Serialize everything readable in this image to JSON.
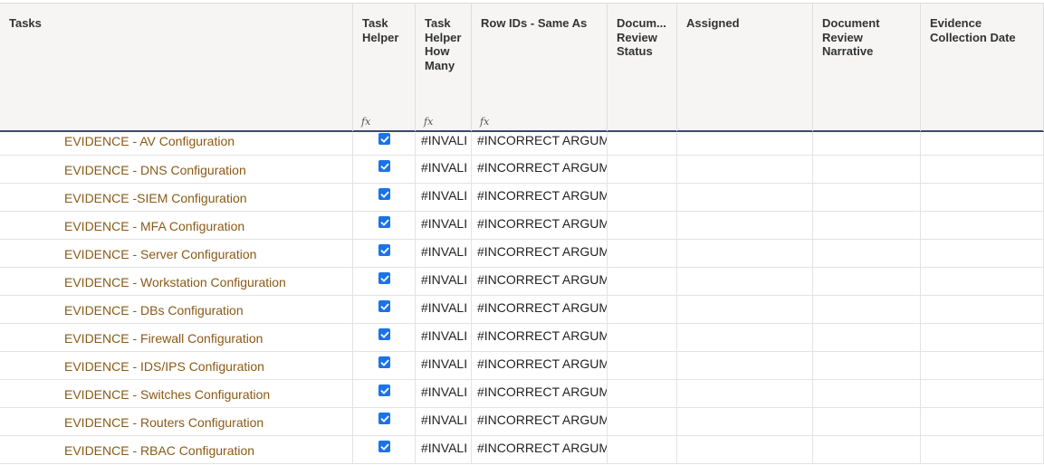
{
  "columns": [
    {
      "key": "tasks",
      "label": "Tasks",
      "formula": false
    },
    {
      "key": "task_helper",
      "label": "Task Helper",
      "formula": true
    },
    {
      "key": "task_helper_how_many",
      "label": "Task Helper How Many",
      "formula": true
    },
    {
      "key": "row_ids",
      "label": "Row IDs - Same As",
      "formula": true
    },
    {
      "key": "doc_review_status",
      "label": "Docum... Review Status",
      "formula": false
    },
    {
      "key": "assigned",
      "label": "Assigned",
      "formula": false
    },
    {
      "key": "doc_review_narrative",
      "label": "Document Review Narrative",
      "formula": false
    },
    {
      "key": "evidence_date",
      "label": "Evidence Collection Date",
      "formula": false
    }
  ],
  "formula_icon": "fx",
  "rows": [
    {
      "task": "EVIDENCE - AV Configuration",
      "helper_checked": true,
      "how_many": "#INVALI",
      "row_ids": "#INCORRECT ARGUM"
    },
    {
      "task": "EVIDENCE - DNS Configuration",
      "helper_checked": true,
      "how_many": "#INVALI",
      "row_ids": "#INCORRECT ARGUM"
    },
    {
      "task": "EVIDENCE -SIEM Configuration",
      "helper_checked": true,
      "how_many": "#INVALI",
      "row_ids": "#INCORRECT ARGUM"
    },
    {
      "task": "EVIDENCE - MFA Configuration",
      "helper_checked": true,
      "how_many": "#INVALI",
      "row_ids": "#INCORRECT ARGUM"
    },
    {
      "task": "EVIDENCE - Server Configuration",
      "helper_checked": true,
      "how_many": "#INVALI",
      "row_ids": "#INCORRECT ARGUM"
    },
    {
      "task": "EVIDENCE - Workstation Configuration",
      "helper_checked": true,
      "how_many": "#INVALI",
      "row_ids": "#INCORRECT ARGUM"
    },
    {
      "task": "EVIDENCE - DBs Configuration",
      "helper_checked": true,
      "how_many": "#INVALI",
      "row_ids": "#INCORRECT ARGUM"
    },
    {
      "task": "EVIDENCE - Firewall Configuration",
      "helper_checked": true,
      "how_many": "#INVALI",
      "row_ids": "#INCORRECT ARGUM"
    },
    {
      "task": "EVIDENCE - IDS/IPS Configuration",
      "helper_checked": true,
      "how_many": "#INVALI",
      "row_ids": "#INCORRECT ARGUM"
    },
    {
      "task": "EVIDENCE - Switches Configuration",
      "helper_checked": true,
      "how_many": "#INVALI",
      "row_ids": "#INCORRECT ARGUM"
    },
    {
      "task": "EVIDENCE - Routers Configuration",
      "helper_checked": true,
      "how_many": "#INVALI",
      "row_ids": "#INCORRECT ARGUM"
    },
    {
      "task": "EVIDENCE - RBAC Configuration",
      "helper_checked": true,
      "how_many": "#INVALI",
      "row_ids": "#INCORRECT ARGUM"
    }
  ],
  "colors": {
    "task_text": "#8a5a16",
    "checkbox": "#1a73e8",
    "header_bg": "#f6f5f4",
    "header_rule": "#3a4a6b"
  }
}
